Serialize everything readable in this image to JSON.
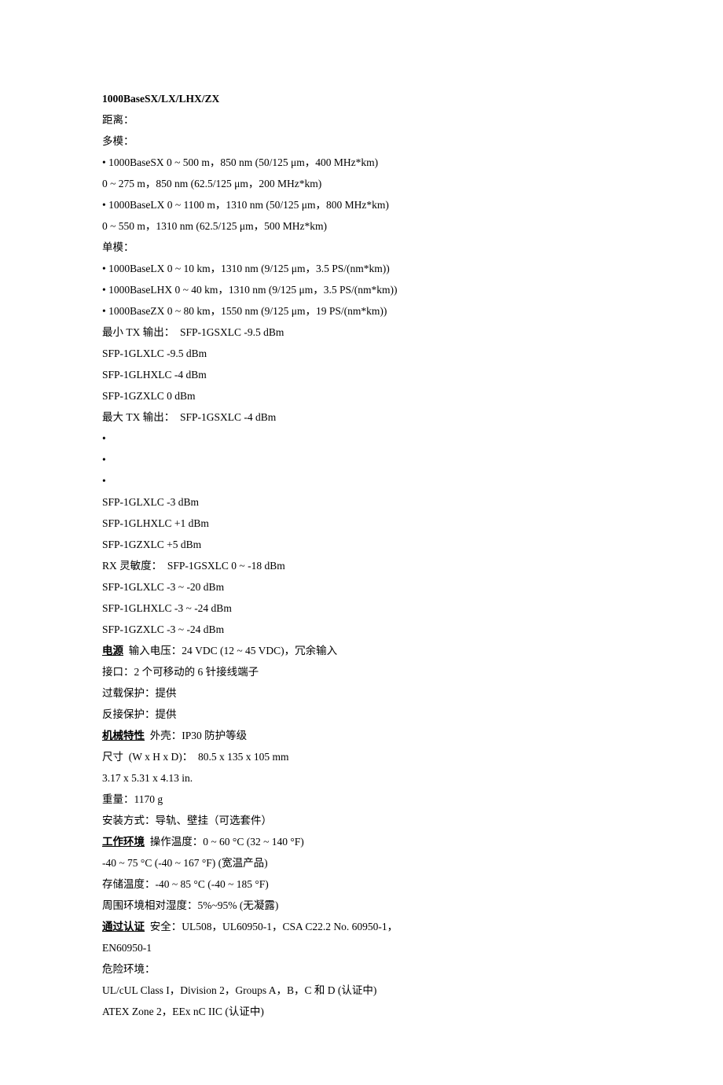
{
  "lines": [
    {
      "style": "bold",
      "text": "1000BaseSX/LX/LHX/ZX"
    },
    {
      "style": "plain",
      "text": "距离："
    },
    {
      "style": "plain",
      "text": "多模："
    },
    {
      "style": "plain",
      "text": "• 1000BaseSX 0 ~ 500 m，850 nm (50/125 μm，400 MHz*km)"
    },
    {
      "style": "plain",
      "text": "0 ~ 275 m，850 nm (62.5/125 μm，200 MHz*km)"
    },
    {
      "style": "plain",
      "text": "• 1000BaseLX 0 ~ 1100 m，1310 nm (50/125 μm，800 MHz*km)"
    },
    {
      "style": "plain",
      "text": "0 ~ 550 m，1310 nm (62.5/125 μm，500 MHz*km)"
    },
    {
      "style": "plain",
      "text": "单模："
    },
    {
      "style": "plain",
      "text": "• 1000BaseLX 0 ~ 10 km，1310 nm (9/125 μm，3.5 PS/(nm*km))"
    },
    {
      "style": "plain",
      "text": "• 1000BaseLHX 0 ~ 40 km，1310 nm (9/125 μm，3.5 PS/(nm*km))"
    },
    {
      "style": "plain",
      "text": "• 1000BaseZX 0 ~ 80 km，1550 nm (9/125 μm，19 PS/(nm*km))"
    },
    {
      "style": "plain",
      "text": "最小 TX 输出：  SFP-1GSXLC -9.5 dBm"
    },
    {
      "style": "plain",
      "text": "SFP-1GLXLC -9.5 dBm"
    },
    {
      "style": "plain",
      "text": "SFP-1GLHXLC -4 dBm"
    },
    {
      "style": "plain",
      "text": "SFP-1GZXLC 0 dBm"
    },
    {
      "style": "plain",
      "text": "最大 TX 输出：  SFP-1GSXLC -4 dBm"
    },
    {
      "style": "plain",
      "text": "•"
    },
    {
      "style": "plain",
      "text": "•"
    },
    {
      "style": "plain",
      "text": "•"
    },
    {
      "style": "plain",
      "text": "SFP-1GLXLC -3 dBm"
    },
    {
      "style": "plain",
      "text": "SFP-1GLHXLC +1 dBm"
    },
    {
      "style": "plain",
      "text": "SFP-1GZXLC +5 dBm"
    },
    {
      "style": "plain",
      "text": "RX 灵敏度：  SFP-1GSXLC 0 ~ -18 dBm"
    },
    {
      "style": "plain",
      "text": "SFP-1GLXLC -3 ~ -20 dBm"
    },
    {
      "style": "plain",
      "text": "SFP-1GLHXLC -3 ~ -24 dBm"
    },
    {
      "style": "plain",
      "text": "SFP-1GZXLC -3 ~ -24 dBm"
    },
    {
      "style": "labeled",
      "label": "电源",
      "rest": "  输入电压：24 VDC (12 ~ 45 VDC)，冗余输入"
    },
    {
      "style": "plain",
      "text": "接口：2 个可移动的 6 针接线端子"
    },
    {
      "style": "plain",
      "text": "过载保护：提供"
    },
    {
      "style": "plain",
      "text": "反接保护：提供"
    },
    {
      "style": "labeled",
      "label": "机械特性",
      "rest": "  外壳：IP30 防护等级"
    },
    {
      "style": "plain",
      "text": "尺寸  (W x H x D)：  80.5 x 135 x 105 mm"
    },
    {
      "style": "plain",
      "text": "3.17 x 5.31 x 4.13 in."
    },
    {
      "style": "plain",
      "text": "重量：1170 g"
    },
    {
      "style": "plain",
      "text": "安装方式：导轨、壁挂（可选套件）"
    },
    {
      "style": "labeled",
      "label": "工作环境",
      "rest": "  操作温度：0 ~ 60 °C (32 ~ 140 °F)"
    },
    {
      "style": "plain",
      "text": "-40 ~ 75 °C (-40 ~ 167 °F) (宽温产品)"
    },
    {
      "style": "plain",
      "text": "存储温度：-40 ~ 85 °C (-40 ~ 185 °F)"
    },
    {
      "style": "plain",
      "text": "周围环境相对湿度：5%~95% (无凝露)"
    },
    {
      "style": "labeled",
      "label": "通过认证",
      "rest": "  安全：UL508，UL60950-1，CSA C22.2 No. 60950-1，"
    },
    {
      "style": "plain",
      "text": "EN60950-1"
    },
    {
      "style": "plain",
      "text": "危险环境："
    },
    {
      "style": "plain",
      "text": "UL/cUL Class I，Division 2，Groups A，B，C 和 D (认证中)"
    },
    {
      "style": "plain",
      "text": "ATEX Zone 2，EEx nC IIC (认证中)"
    }
  ]
}
